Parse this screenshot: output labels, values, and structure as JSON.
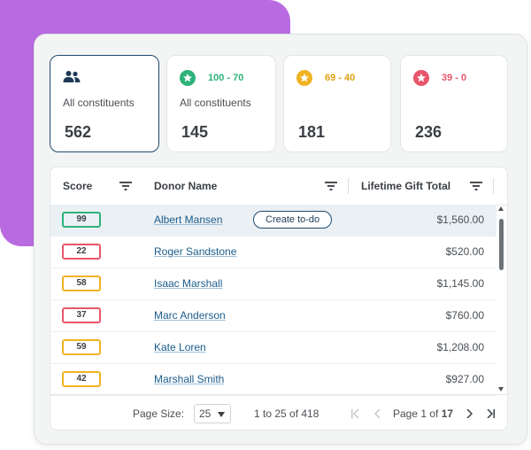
{
  "cards": [
    {
      "icon": "people-icon",
      "range": "",
      "label": "All constituents",
      "count": "562",
      "color": "#1e3a55"
    },
    {
      "icon": "star-badge-icon",
      "range": "100 - 70",
      "label": "All constituents",
      "count": "145",
      "color": "#2db37a"
    },
    {
      "icon": "star-badge-icon",
      "range": "69 - 40",
      "label": "",
      "count": "181",
      "color": "#f0b323"
    },
    {
      "icon": "star-badge-icon",
      "range": "39 - 0",
      "label": "",
      "count": "236",
      "color": "#e8566b"
    }
  ],
  "table": {
    "headers": {
      "score": "Score",
      "donor": "Donor Name",
      "total": "Lifetime Gift Total"
    },
    "rows": [
      {
        "score": "99",
        "name": "Albert Mansen",
        "amount": "$1,560.00",
        "color": "#2db37a"
      },
      {
        "score": "22",
        "name": "Roger Sandstone",
        "amount": "$520.00",
        "color": "#e8566b"
      },
      {
        "score": "58",
        "name": "Isaac Marshall",
        "amount": "$1,145.00",
        "color": "#f0b323"
      },
      {
        "score": "37",
        "name": "Marc Anderson",
        "amount": "$760.00",
        "color": "#e8566b"
      },
      {
        "score": "59",
        "name": "Kate Loren",
        "amount": "$1,208.00",
        "color": "#f0b323"
      },
      {
        "score": "42",
        "name": "Marshall Smith",
        "amount": "$927.00",
        "color": "#f0b323"
      }
    ],
    "todo_label": "Create to-do"
  },
  "footer": {
    "page_size_label": "Page Size:",
    "page_size_value": "25",
    "range_text": "1 to 25 of 418",
    "page_prefix": "Page 1 of",
    "page_total": "17"
  }
}
